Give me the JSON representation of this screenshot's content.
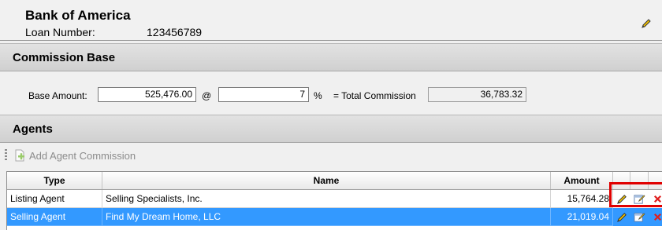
{
  "header": {
    "bank_name": "Bank of America",
    "loan_label": "Loan Number:",
    "loan_number": "123456789"
  },
  "commission_base": {
    "section_title": "Commission Base",
    "base_amount_label": "Base Amount:",
    "base_amount_value": "525,476.00",
    "at_symbol": "@",
    "percent_value": "7",
    "percent_symbol": "%",
    "total_label": "= Total Commission",
    "total_value": "36,783.32"
  },
  "agents": {
    "section_title": "Agents",
    "add_button_label": "Add Agent Commission",
    "columns": [
      "Type",
      "Name",
      "Amount"
    ],
    "rows": [
      {
        "type": "Listing Agent",
        "name": "Selling Specialists, Inc.",
        "amount": "15,764.28"
      },
      {
        "type": "Selling Agent",
        "name": "Find My Dream Home, LLC",
        "amount": "21,019.04"
      }
    ]
  },
  "icons": {
    "header_edit": "pencil-icon",
    "add": "add-document-icon",
    "row_edit": "pencil-icon",
    "row_notes": "edit-notes-icon",
    "row_delete": "delete-x-icon"
  },
  "colors": {
    "selection": "#3399ff",
    "highlight": "#e00000"
  }
}
